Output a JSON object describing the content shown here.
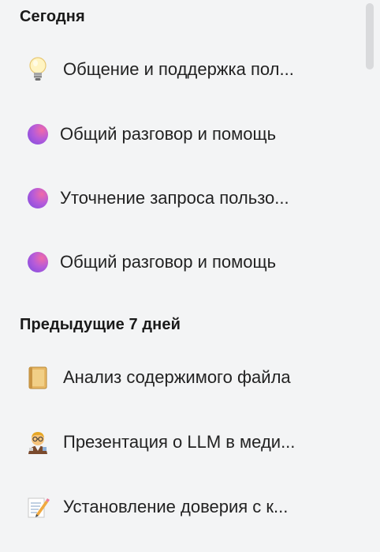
{
  "sections": {
    "today": {
      "title": "Сегодня",
      "items": [
        {
          "label": "Общение и поддержка пол...",
          "icon": "lightbulb-icon"
        },
        {
          "label": "Общий разговор и помощь",
          "icon": "gradient-orb-icon"
        },
        {
          "label": "Уточнение запроса пользо...",
          "icon": "gradient-orb-icon"
        },
        {
          "label": "Общий разговор и помощь",
          "icon": "gradient-orb-icon"
        }
      ]
    },
    "previous7": {
      "title": "Предыдущие 7 дней",
      "items": [
        {
          "label": "Анализ содержимого файла",
          "icon": "folder-icon"
        },
        {
          "label": "Презентация о LLM в меди...",
          "icon": "scientist-icon"
        },
        {
          "label": "Установление доверия с к...",
          "icon": "memo-icon"
        }
      ]
    }
  },
  "colors": {
    "background": "#f3f4f5",
    "orb_start": "#f06aa8",
    "orb_end": "#7a4be0"
  }
}
